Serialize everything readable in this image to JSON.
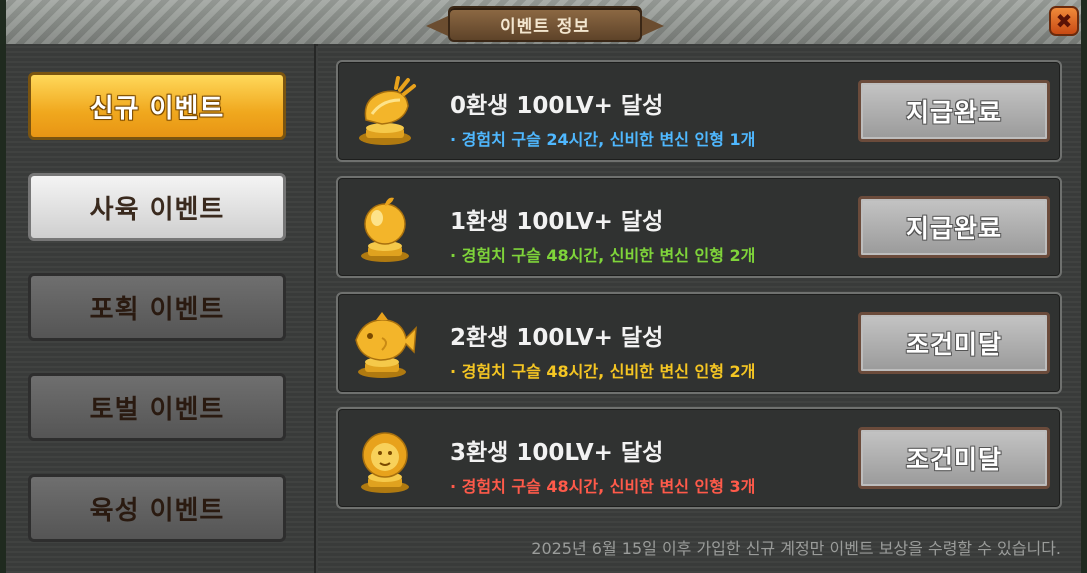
{
  "window": {
    "title": "이벤트 정보",
    "close_label": "✖"
  },
  "categories": [
    {
      "label": "신규 이벤트",
      "state": "active"
    },
    {
      "label": "사육 이벤트",
      "state": "available"
    },
    {
      "label": "포획 이벤트",
      "state": "locked"
    },
    {
      "label": "토벌 이벤트",
      "state": "locked"
    },
    {
      "label": "육성 이벤트",
      "state": "locked"
    }
  ],
  "events": [
    {
      "trophy": "golden-carrot-trophy-icon",
      "title": "0환생 100LV+ 달성",
      "reward": "· 경험치 구슬 24시간, 신비한 변신 인형 1개",
      "reward_color": "#4fb8ff",
      "status": "지급완료"
    },
    {
      "trophy": "golden-apple-trophy-icon",
      "title": "1환생 100LV+ 달성",
      "reward": "· 경험치 구슬 48시간, 신비한 변신 인형 2개",
      "reward_color": "#7fd43a",
      "status": "지급완료"
    },
    {
      "trophy": "golden-fish-trophy-icon",
      "title": "2환생 100LV+ 달성",
      "reward": "· 경험치 구슬 48시간, 신비한 변신 인형 2개",
      "reward_color": "#f5c623",
      "status": "조건미달"
    },
    {
      "trophy": "golden-lion-trophy-icon",
      "title": "3환생 100LV+ 달성",
      "reward": "· 경험치 구슬 48시간, 신비한 변신 인형 3개",
      "reward_color": "#ff5a4a",
      "status": "조건미달"
    }
  ],
  "footer_note": "2025년 6월 15일 이후 가입한 신규 계정만 이벤트 보상을 수령할 수 있습니다."
}
